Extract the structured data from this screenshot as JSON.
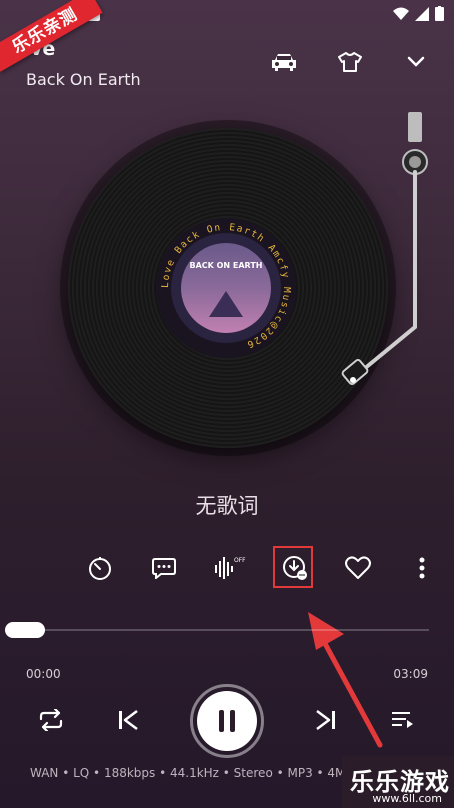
{
  "watermark_top": "乐乐亲测",
  "header": {
    "song_title_fragment": "ve",
    "artist": "Back On Earth"
  },
  "top_actions": [
    "car-icon",
    "tshirt-icon",
    "chevron-down-icon"
  ],
  "disc": {
    "label_ring_text": "Love Back On Earth Amcfy Music@2026",
    "art_title": "BACK ON EARTH"
  },
  "lyrics": "无歌词",
  "actions": [
    "timer-icon",
    "comment-icon",
    "audio-effect-icon",
    "download-icon",
    "heart-icon",
    "more-icon"
  ],
  "audio_effect_badge": "OFF",
  "progress": {
    "elapsed": "00:00",
    "duration": "03:09",
    "fraction": 0.0
  },
  "controls": [
    "repeat-icon",
    "previous-icon",
    "pause-icon",
    "next-icon",
    "playlist-icon"
  ],
  "audio_info": "WAN • LQ • 188kbps • 44.1kHz • Stereo • MP3 • 4MB",
  "watermark_bottom": {
    "big": "乐乐游戏",
    "small": "www.6ll.com"
  },
  "colors": {
    "highlight": "#e3393b",
    "watermark": "#e0262e"
  }
}
